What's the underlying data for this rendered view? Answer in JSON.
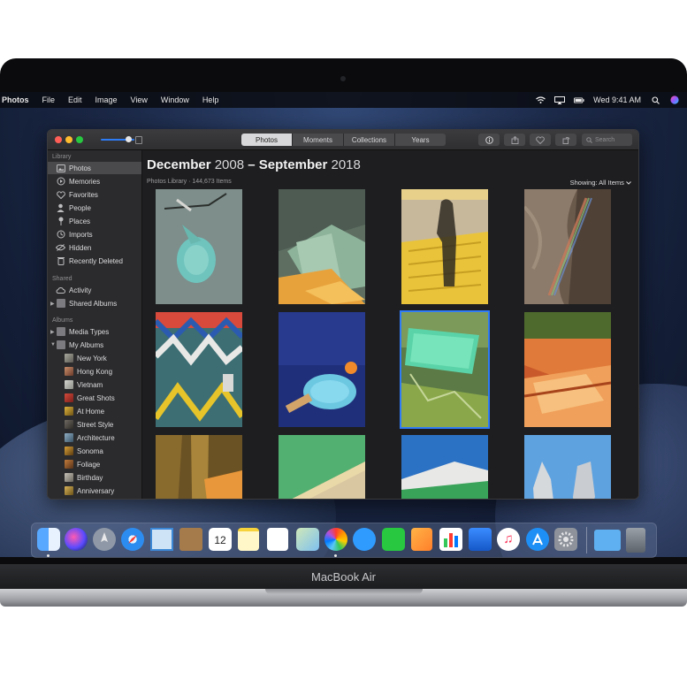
{
  "menubar": {
    "app_name": "Photos",
    "menus": [
      "File",
      "Edit",
      "Image",
      "View",
      "Window",
      "Help"
    ],
    "clock": "Wed 9:41 AM"
  },
  "toolbar": {
    "tabs": [
      "Photos",
      "Moments",
      "Collections",
      "Years"
    ],
    "selected_tab": "Photos",
    "search_placeholder": "Search"
  },
  "sidebar": {
    "sections": {
      "library": "Library",
      "shared": "Shared",
      "albums": "Albums"
    },
    "library_items": [
      "Photos",
      "Memories",
      "Favorites",
      "People",
      "Places",
      "Imports",
      "Hidden",
      "Recently Deleted"
    ],
    "shared_items": [
      "Activity",
      "Shared Albums"
    ],
    "album_items": [
      "Media Types",
      "My Albums"
    ],
    "my_albums": [
      "New York",
      "Hong Kong",
      "Vietnam",
      "Great Shots",
      "At Home",
      "Street Style",
      "Architecture",
      "Sonoma",
      "Foliage",
      "Birthday",
      "Anniversary"
    ]
  },
  "content": {
    "title_from": "December",
    "title_from_year": "2008",
    "title_sep": "–",
    "title_to": "September",
    "title_to_year": "2018",
    "subtitle": "Photos Library · 144,673 Items",
    "showing": "Showing: All Items"
  },
  "device": {
    "name": "MacBook Air"
  },
  "colors": {
    "accent": "#2f7cf6",
    "selection": "#4a4a4d"
  },
  "dock": {
    "apps": [
      "finder-icon",
      "siri-icon",
      "launchpad-icon",
      "safari-icon",
      "mail-icon",
      "contacts-icon",
      "calendar-icon",
      "notes-icon",
      "reminders-icon",
      "maps-icon",
      "photos-icon",
      "messages-icon",
      "facetime-icon",
      "pages-icon",
      "numbers-icon",
      "keynote-icon",
      "music-icon",
      "app-store-icon",
      "system-preferences-icon",
      "downloads-folder-icon",
      "trash-icon"
    ],
    "calendar_day": "12"
  }
}
